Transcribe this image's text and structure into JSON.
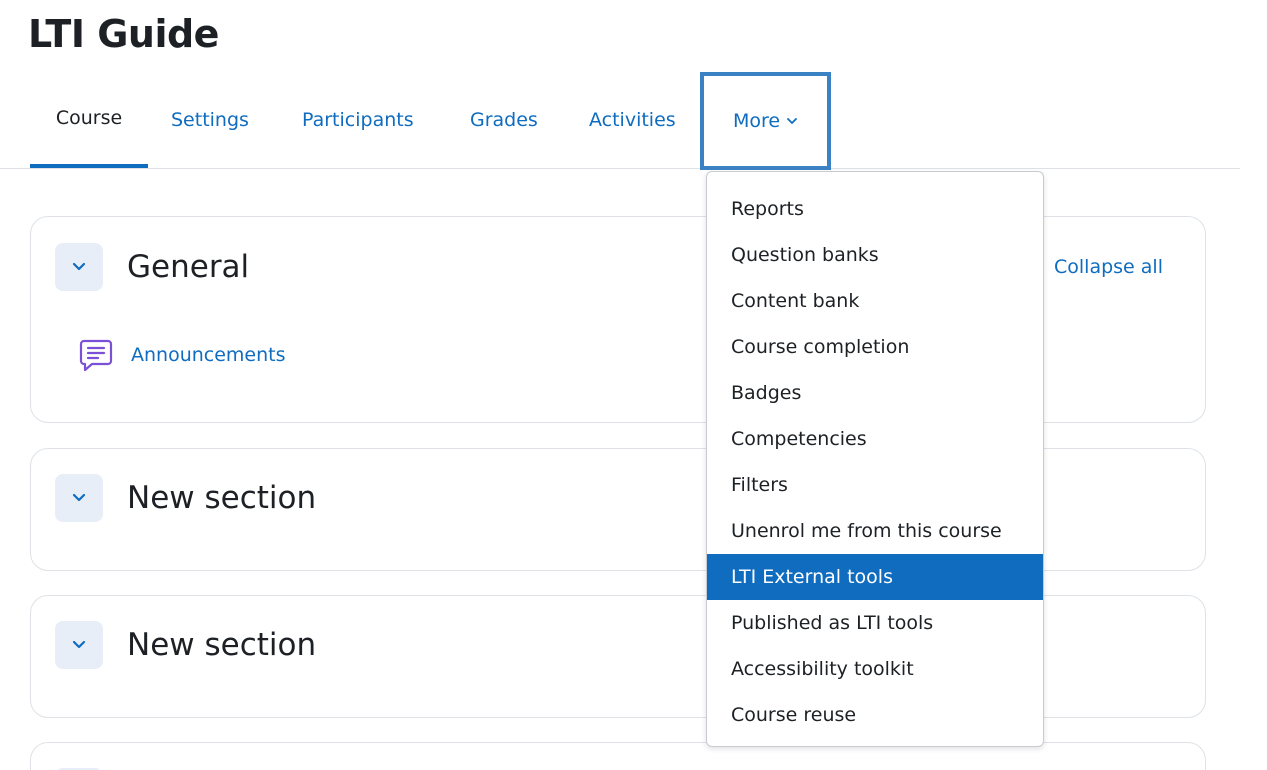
{
  "page": {
    "title": "LTI Guide"
  },
  "nav": {
    "tabs": [
      {
        "label": "Course",
        "active": true
      },
      {
        "label": "Settings",
        "active": false
      },
      {
        "label": "Participants",
        "active": false
      },
      {
        "label": "Grades",
        "active": false
      },
      {
        "label": "Activities",
        "active": false
      }
    ],
    "more_label": "More"
  },
  "sections": [
    {
      "title": "General",
      "activities": [
        {
          "label": "Announcements",
          "icon": "forum-icon"
        }
      ]
    },
    {
      "title": "New section",
      "activities": []
    },
    {
      "title": "New section",
      "activities": []
    }
  ],
  "collapse_all_label": "Collapse all",
  "more_menu": {
    "items": [
      "Reports",
      "Question banks",
      "Content bank",
      "Course completion",
      "Badges",
      "Competencies",
      "Filters",
      "Unenrol me from this course",
      "LTI External tools",
      "Published as LTI tools",
      "Accessibility toolkit",
      "Course reuse"
    ],
    "highlighted_item": "LTI External tools"
  },
  "colors": {
    "primary": "#0f6cbf",
    "text": "#1d2125",
    "focus_outline": "#3b82c4",
    "collapse_button_bg": "#e8eef7",
    "forum_icon": "#7b4fd6"
  }
}
